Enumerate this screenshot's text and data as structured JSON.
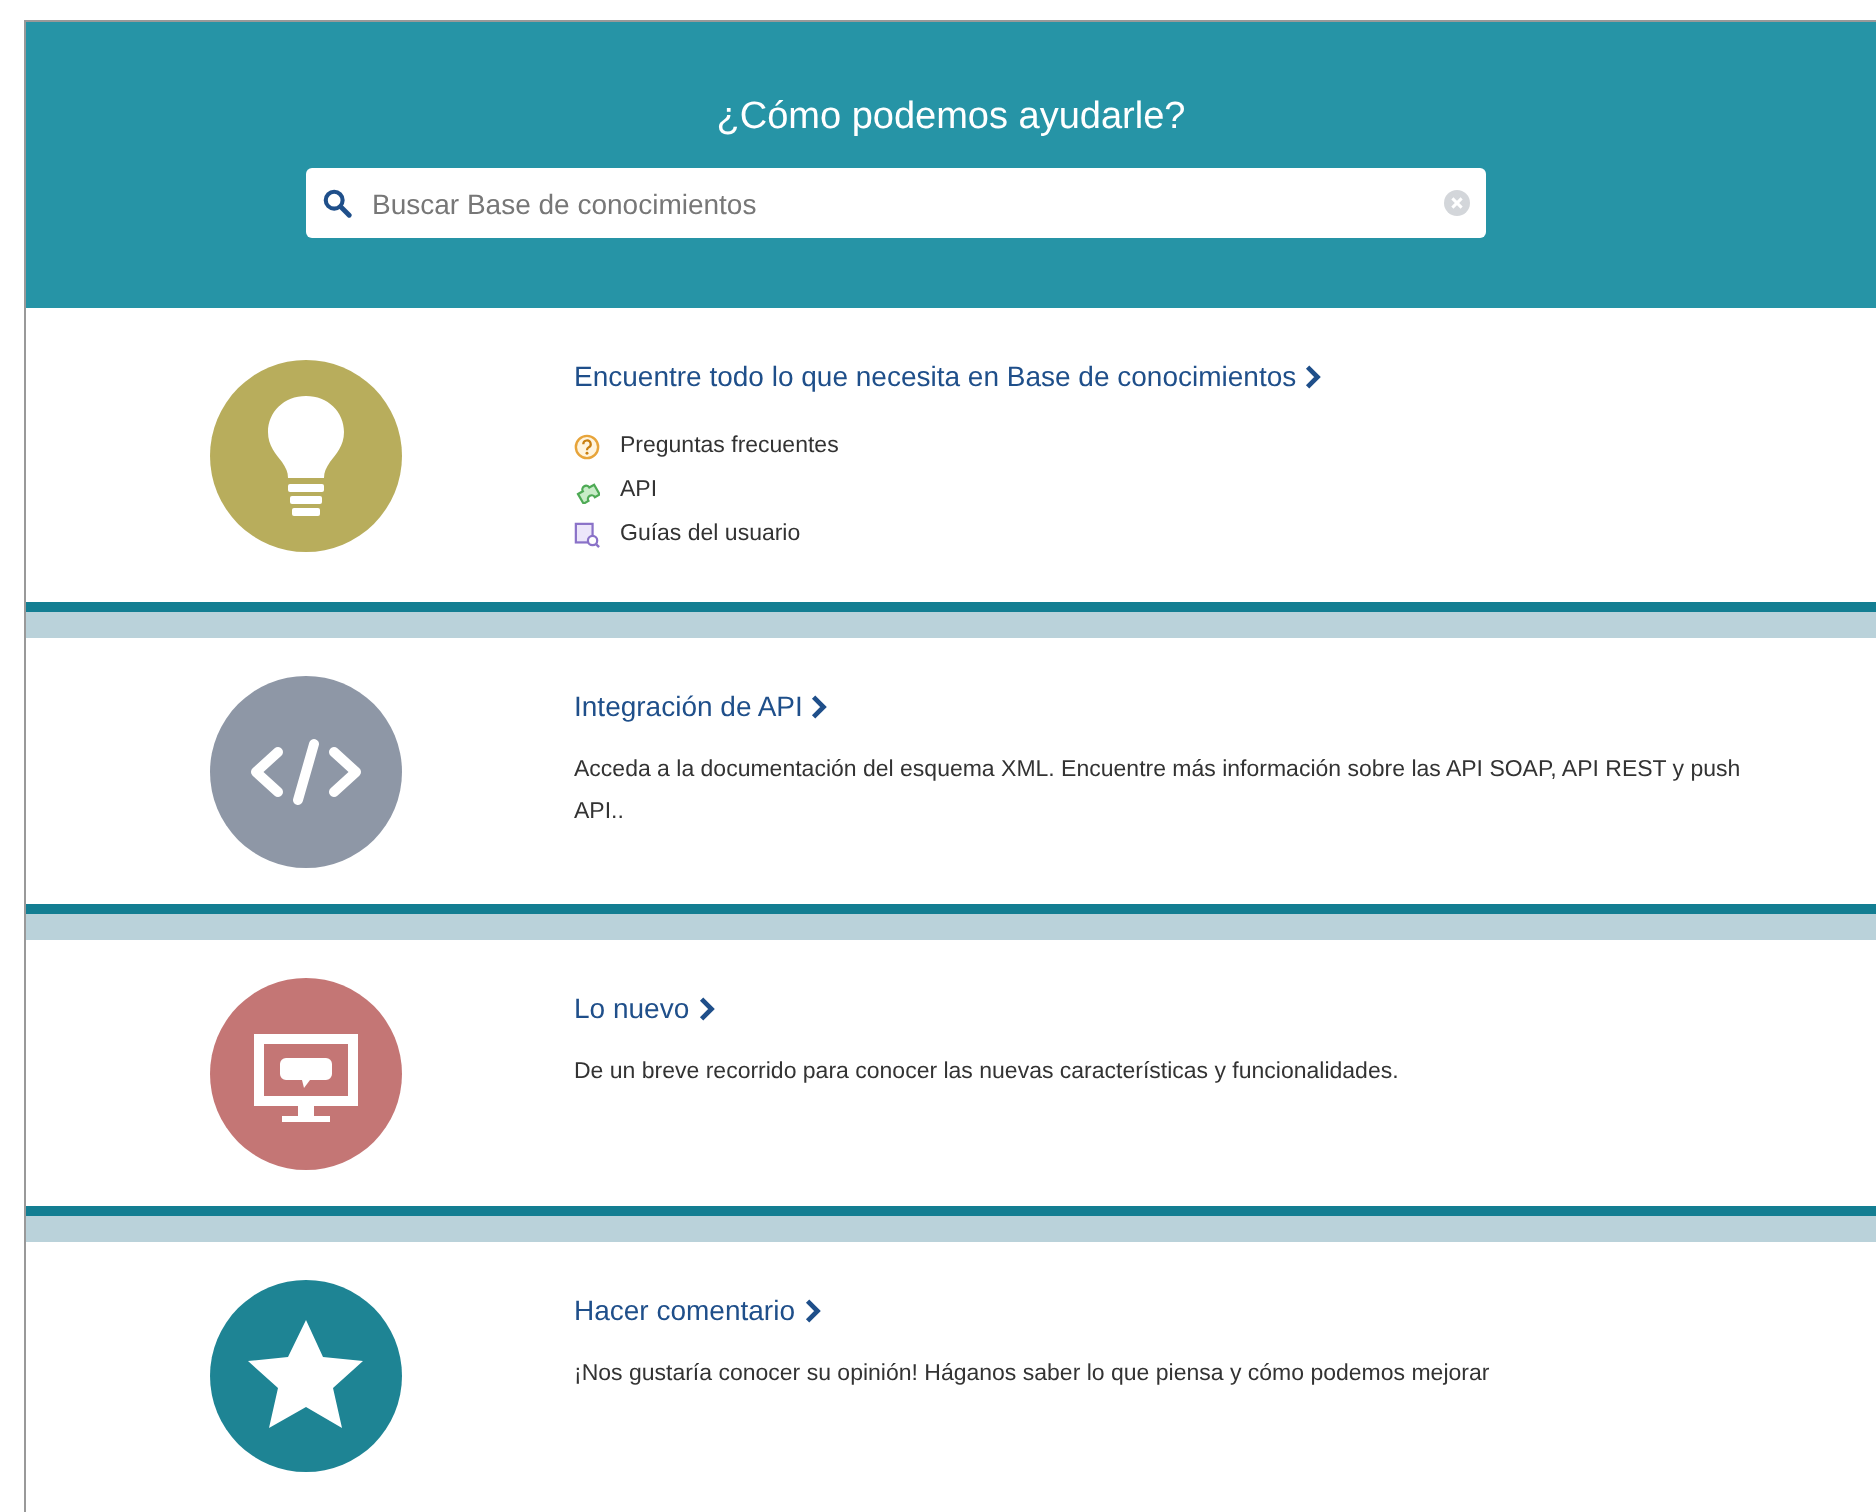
{
  "header": {
    "title": "¿Cómo podemos ayudarle?",
    "search": {
      "placeholder": "Buscar Base de conocimientos"
    }
  },
  "sections": [
    {
      "kind": "bulb",
      "color": "#b8ad5c",
      "title": "Encuentre todo lo que necesita en Base de conocimientos",
      "links": [
        {
          "kind": "question",
          "label": "Preguntas frecuentes"
        },
        {
          "kind": "puzzle",
          "label": "API"
        },
        {
          "kind": "guide",
          "label": "Guías del usuario"
        }
      ]
    },
    {
      "kind": "code",
      "color": "#8e97a6",
      "title": "Integración de API",
      "text": "Acceda a la documentación del esquema XML. Encuentre más información sobre las API SOAP, API REST y push API.."
    },
    {
      "kind": "monitor",
      "color": "#c47675",
      "title": "Lo nuevo",
      "text": "De un breve recorrido para conocer las nuevas características y funcionalidades."
    },
    {
      "kind": "star",
      "color": "#1e8494",
      "title": "Hacer comentario",
      "text": "¡Nos gustaría conocer su opinión! Háganos saber lo que piensa y cómo podemos mejorar"
    }
  ]
}
